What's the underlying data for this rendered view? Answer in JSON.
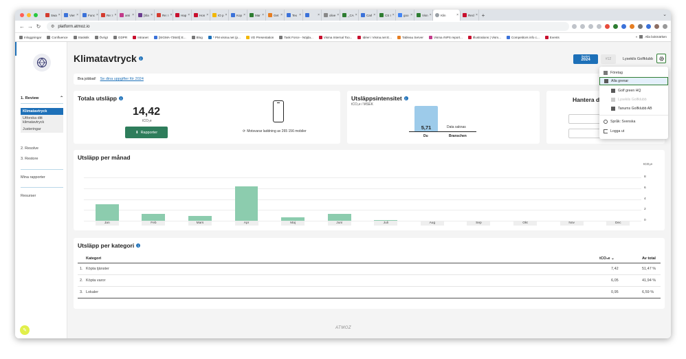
{
  "browser": {
    "tabs": [
      {
        "label": "Swa",
        "color": "#d33b2f"
      },
      {
        "label": "Vier",
        "color": "#3b72d9"
      },
      {
        "label": "Func",
        "color": "#3b72d9"
      },
      {
        "label": "Re: I",
        "color": "#d33b2f"
      },
      {
        "label": "ami",
        "color": "#c23b8b"
      },
      {
        "label": "[Sla",
        "color": "#6a3d8f"
      },
      {
        "label": "Re: I",
        "color": "#d33b2f"
      },
      {
        "label": "Hap",
        "color": "#c8102e"
      },
      {
        "label": "Hon",
        "color": "#c8102e"
      },
      {
        "label": "IO p",
        "color": "#f2b705"
      },
      {
        "label": "Kop",
        "color": "#3b72d9"
      },
      {
        "label": "Mar",
        "color": "#2e7d32"
      },
      {
        "label": "Get",
        "color": "#e67e22"
      },
      {
        "label": "Tex",
        "color": "#3b72d9"
      },
      {
        "label": "",
        "color": "#3b72d9"
      },
      {
        "label": "olive",
        "color": "#888888"
      },
      {
        "label": "_CA",
        "color": "#2e7d32"
      },
      {
        "label": "Carl",
        "color": "#3b72d9"
      },
      {
        "label": "CS I",
        "color": "#2e7d32"
      },
      {
        "label": "goo",
        "color": "#4285f4"
      },
      {
        "label": "Visn",
        "color": "#2e7d32"
      }
    ],
    "active_tab": "Klin",
    "last_tab": "Recl",
    "new_tab": "+",
    "url": "platform.atmoz.io",
    "bookmarks": [
      "Inloggningar",
      "Confluence",
      "Statistik",
      "Övrigt",
      "GDPR",
      "Intranet",
      "[SIGMA-73640] E...",
      "Blog",
      "* PM visma.net (p...",
      "VD Presentation",
      "Task Force - Nöjda...",
      "Visma Internal Too...",
      "Idéer i Visma.net E...",
      "Tableau Server",
      "Visma rNPS report...",
      "Illustrations | Vism...",
      "Competitors info c...",
      "Events"
    ],
    "bookmarks_more": "»",
    "all_bookmarks": "Alla bokmärken"
  },
  "sidebar": {
    "section_review": "1. Review",
    "items": [
      "Klimatavtryck",
      "Utforska ditt klimatavtryck",
      "Justeringar"
    ],
    "resolve": "2. Resolve",
    "restore": "3. Restore",
    "reports": "Mina rapporter",
    "resources": "Resurser"
  },
  "header": {
    "title": "Klimatavtryck",
    "year_label": "Basåret",
    "year": "2024",
    "year_num": "#12",
    "club": "Lysekils Golfklubb"
  },
  "message": {
    "text": "Bra jobbat!",
    "link": "Se dina uppgifter för 2024"
  },
  "totals": {
    "title": "Totala utsläpp",
    "value": "14,42",
    "unit": "tCO₂e",
    "button": "Rapporter",
    "phone_text": "Motsvarar laddning av 265 156 mobiler"
  },
  "intensity": {
    "title": "Utsläppsintensitet",
    "unit": "tCO₂e / MSEK",
    "value": "5,71",
    "nodata": "Data saknas",
    "label_you": "Du",
    "label_industry": "Branschen"
  },
  "hantera": {
    "title": "Hantera d"
  },
  "monthly": {
    "title": "Utsläpp per månad",
    "unit": "tCO₂e",
    "yticks": [
      "8",
      "6",
      "4",
      "2",
      "0"
    ]
  },
  "chart_data": {
    "type": "bar",
    "title": "Utsläpp per månad",
    "ylabel": "tCO₂e",
    "categories": [
      "Jan",
      "Feb",
      "Mars",
      "Apr",
      "Maj",
      "Juni",
      "Juli",
      "Aug",
      "Sep",
      "Okt",
      "Nov",
      "Dec"
    ],
    "values": [
      3.1,
      1.3,
      0.9,
      6.3,
      0.6,
      1.3,
      0.1,
      0,
      0,
      0,
      0,
      0
    ],
    "ylim": [
      0,
      8
    ],
    "grid": true
  },
  "category": {
    "title": "Utsläpp per kategori",
    "col_category": "Kategori",
    "col_tco2e": "tCO₂e",
    "col_share": "Av total",
    "rows": [
      {
        "idx": "1.",
        "name": "Köpta tjänster",
        "value": "7,42",
        "share": "51,47 %"
      },
      {
        "idx": "2.",
        "name": "Köpta varor",
        "value": "6,05",
        "share": "41,94 %"
      },
      {
        "idx": "3.",
        "name": "Lokaler",
        "value": "0,95",
        "share": "6,59 %"
      }
    ]
  },
  "footer": {
    "logo": "ATMOZ"
  },
  "dropdown": {
    "items": [
      {
        "label": "Företag",
        "icon": "building-icon"
      },
      {
        "label": "Alla grenar",
        "icon": "branches-icon"
      },
      {
        "label": "Golf green HQ",
        "icon": "branch-icon"
      },
      {
        "label": "Lysekils Golfklubb",
        "icon": "branch-icon"
      },
      {
        "label": "Tanums Golfklubb AB",
        "icon": "branch-icon"
      },
      {
        "label": "Språk: Svenska",
        "icon": "globe-icon"
      },
      {
        "label": "Logga ut",
        "icon": "logout-icon"
      }
    ]
  }
}
